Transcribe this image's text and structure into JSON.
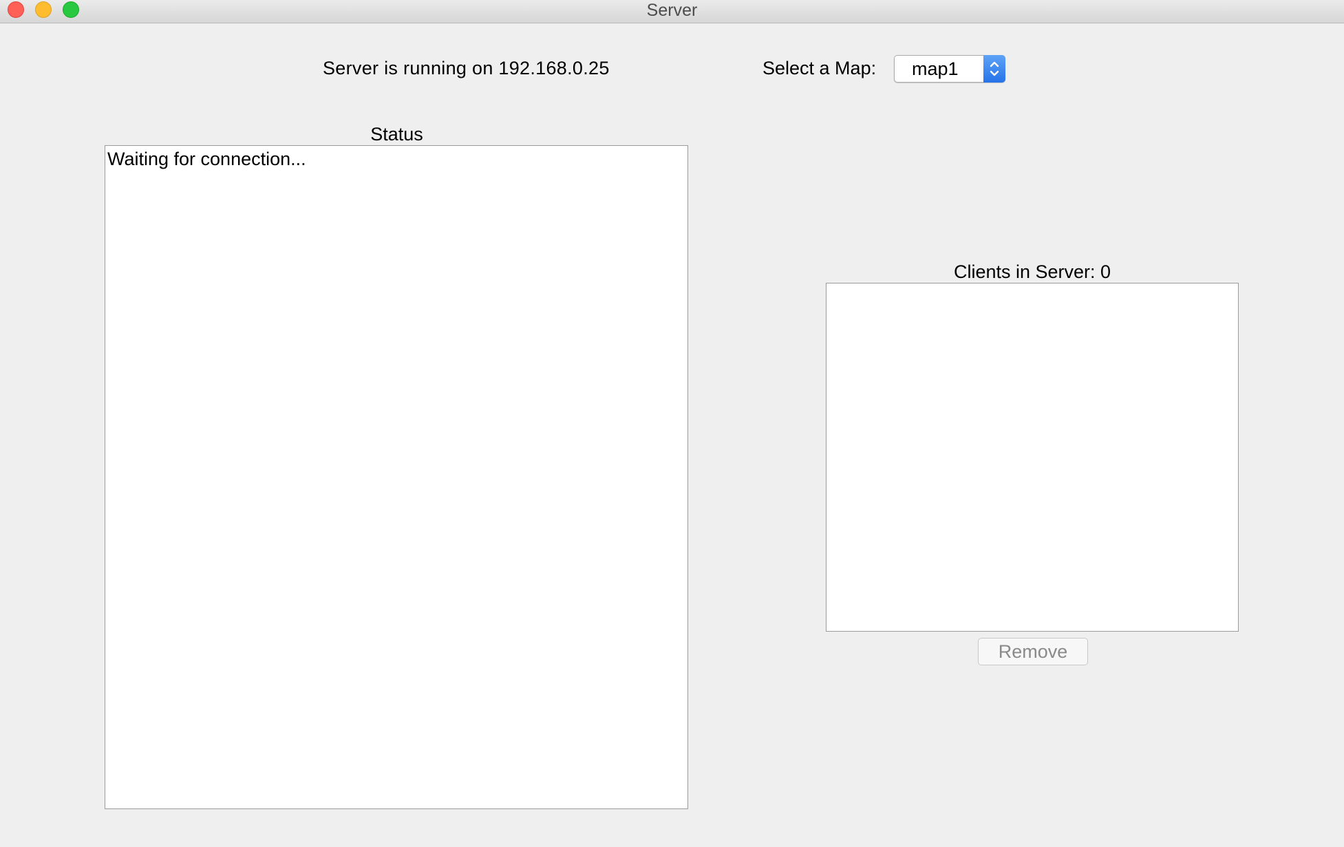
{
  "window": {
    "title": "Server"
  },
  "header": {
    "server_status": "Server is running on 192.168.0.25",
    "map_label": "Select a Map:",
    "map_selected": "map1"
  },
  "status": {
    "label": "Status",
    "text": "Waiting for connection..."
  },
  "clients": {
    "label": "Clients in Server: 0",
    "items": [],
    "remove_label": "Remove"
  },
  "colors": {
    "window_bg": "#efefef",
    "close": "#fe5f57",
    "minimize": "#febc2e",
    "maximize": "#28c840",
    "select_accent": "#2773e8"
  }
}
